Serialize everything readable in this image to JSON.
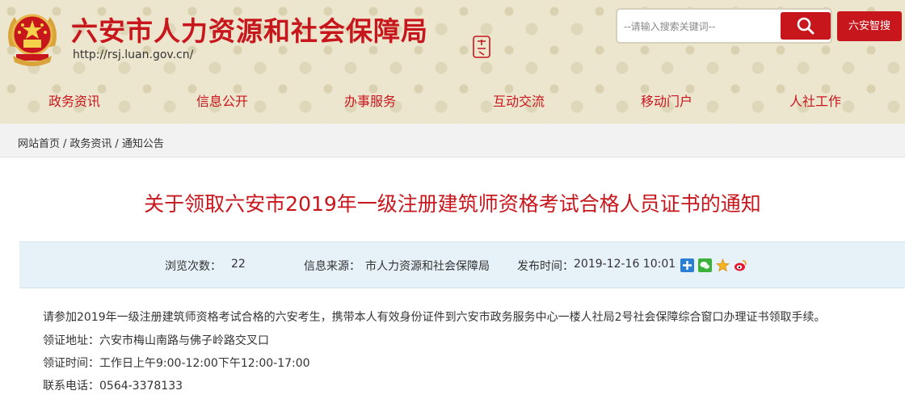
{
  "header": {
    "site_title": "六安市人力资源和社会保障局",
    "site_url": "http://rsj.luan.gov.cn/",
    "search_placeholder": "--请输入搜索关键词--",
    "zhisou_label": "六安智搜"
  },
  "nav": {
    "items": [
      "政务资讯",
      "信息公开",
      "办事服务",
      "互动交流",
      "移动门户",
      "人社工作"
    ]
  },
  "breadcrumb": {
    "items": [
      "网站首页",
      "政务资讯",
      "通知公告"
    ],
    "separator": "/"
  },
  "article": {
    "title": "关于领取六安市2019年一级注册建筑师资格考试合格人员证书的通知",
    "views_label": "浏览次数：",
    "views_count": "22",
    "source_label": "信息来源：",
    "source_value": "市人力资源和社会保障局",
    "publish_label": "发布时间：",
    "publish_value": "2019-12-16 10:01",
    "body": [
      "请参加2019年一级注册建筑师资格考试合格的六安考生，携带本人有效身份证件到六安市政务服务中心一楼人社局2号社会保障综合窗口办理证书领取手续。",
      "领证地址：六安市梅山南路与佛子岭路交叉口",
      "领证时间：工作日上午9:00-12:00下午12:00-17:00",
      "联系电话：0564-3378133"
    ]
  },
  "share_icons": [
    "qzone-icon",
    "wechat-icon",
    "favorite-star-icon",
    "weibo-icon"
  ],
  "colors": {
    "brand_red": "#c8161d",
    "header_bg": "#ece6cf",
    "meta_bar_bg": "#e6f1f8",
    "breadcrumb_bg": "#f2f2f2"
  }
}
